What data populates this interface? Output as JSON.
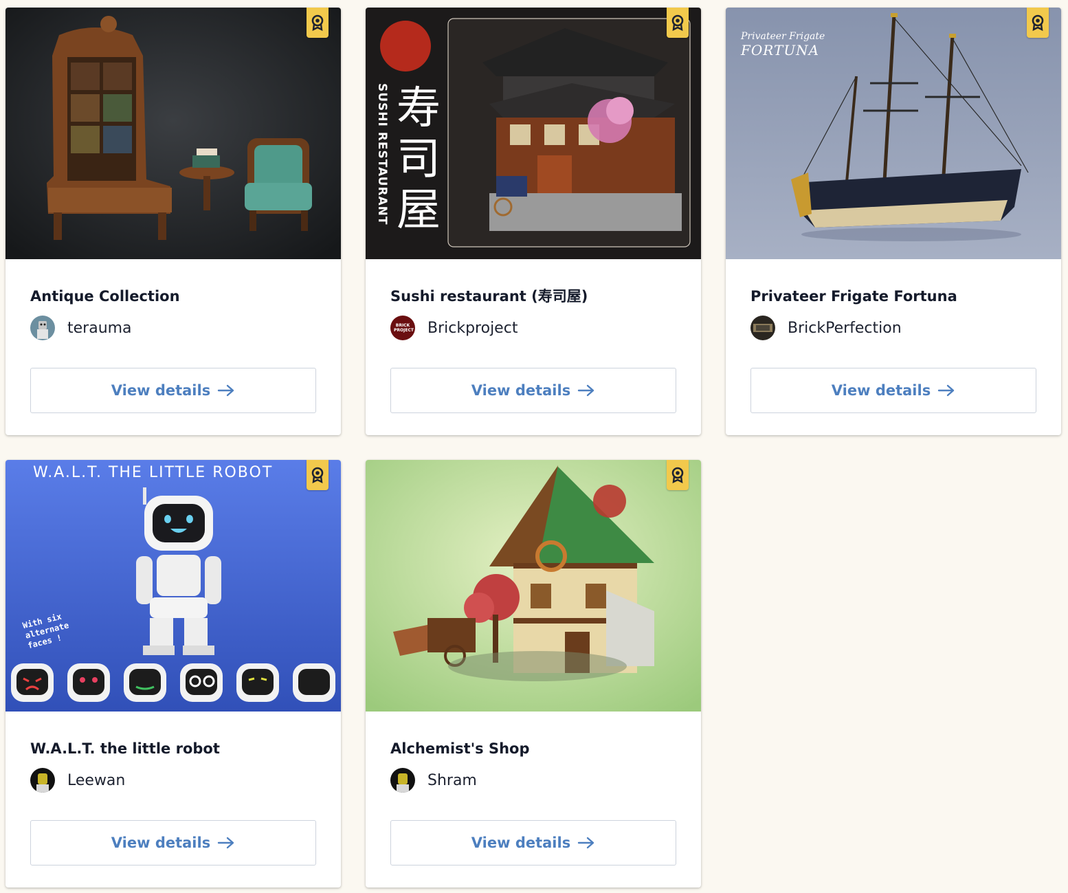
{
  "cards": [
    {
      "title": "Antique Collection",
      "creator": "terauma",
      "button_label": "View details",
      "badge_icon": "award-ribbon-icon",
      "image_alt": "Antique Collection"
    },
    {
      "title": "Sushi restaurant (寿司屋)",
      "creator": "Brickproject",
      "button_label": "View details",
      "badge_icon": "award-ribbon-icon",
      "image_text": {
        "vertical_en": "SUSHI RESTAURANT",
        "kanji": [
          "寿",
          "司",
          "屋"
        ]
      },
      "avatar_text": "BRICK PROJECT"
    },
    {
      "title": "Privateer Frigate Fortuna",
      "creator": "BrickPerfection",
      "button_label": "View details",
      "badge_icon": "award-ribbon-icon",
      "image_text": {
        "line1": "Privateer Frigate",
        "line2": "FORTUNA"
      }
    },
    {
      "title": "W.A.L.T. the little robot",
      "creator": "Leewan",
      "button_label": "View details",
      "badge_icon": "award-ribbon-icon",
      "image_text": {
        "banner": "W.A.L.T. THE LITTLE ROBOT",
        "note": [
          "With six",
          "alternate",
          "faces !"
        ]
      }
    },
    {
      "title": "Alchemist's Shop",
      "creator": "Shram",
      "button_label": "View details",
      "badge_icon": "award-ribbon-icon"
    }
  ],
  "colors": {
    "page_background": "#fbf8f1",
    "badge": "#f2c94c",
    "button_text": "#4d7fbf",
    "title_text": "#151b2b"
  }
}
